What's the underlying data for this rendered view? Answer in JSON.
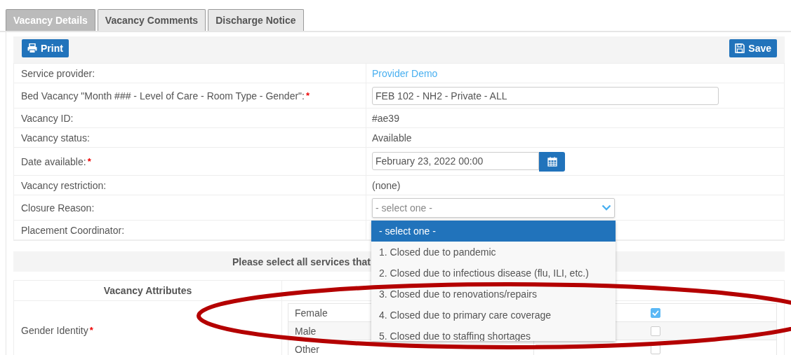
{
  "tabs": [
    {
      "label": "Vacancy Details",
      "selected": true
    },
    {
      "label": "Vacancy Comments",
      "selected": false
    },
    {
      "label": "Discharge Notice",
      "selected": false
    }
  ],
  "toolbar": {
    "print": "Print",
    "save": "Save"
  },
  "fields": [
    {
      "label": "Service provider:",
      "kind": "link",
      "value": "Provider Demo"
    },
    {
      "label": "Bed Vacancy \"Month ### - Level of Care - Room Type - Gender\":",
      "required_mark": "*",
      "kind": "input",
      "value": "FEB 102 - NH2 - Private - ALL"
    },
    {
      "label": "Vacancy ID:",
      "kind": "text",
      "value": "#ae39"
    },
    {
      "label": "Vacancy status:",
      "kind": "text",
      "value": "Available"
    },
    {
      "label": "Date available:",
      "required_mark": "*",
      "kind": "date",
      "value": "February 23, 2022 00:00"
    },
    {
      "label": "Vacancy restriction:",
      "kind": "text",
      "value": "(none)"
    },
    {
      "label": "Closure Reason:",
      "kind": "select",
      "placeholder": "- select one -",
      "expanded": true,
      "options": [
        {
          "label": "- select one -",
          "selected": true
        },
        {
          "label": "1. Closed due to pandemic",
          "selected": false
        },
        {
          "label": "2. Closed due to infectious disease (flu, ILI, etc.)",
          "selected": false
        },
        {
          "label": "3. Closed due to renovations/repairs",
          "selected": false
        },
        {
          "label": "4. Closed due to primary care coverage",
          "selected": false
        },
        {
          "label": "5. Closed due to staffing shortages",
          "selected": false
        }
      ]
    },
    {
      "label": "Placement Coordinator:",
      "kind": "text"
    }
  ],
  "services_banner": "Please select all services that",
  "attributes": {
    "header": "Vacancy Attributes",
    "rows": [
      {
        "label": "Gender Identity",
        "required_mark": "*",
        "options": [
          {
            "label": "Female",
            "checked": true
          },
          {
            "label": "Male",
            "checked": false
          },
          {
            "label": "Other",
            "checked": false
          }
        ]
      }
    ]
  },
  "annotation": {
    "kind": "ellipse"
  }
}
